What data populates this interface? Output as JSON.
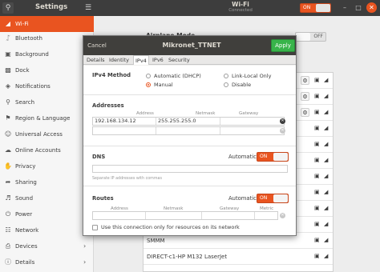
{
  "header": {
    "app_title": "Settings",
    "panel_title": "Wi-Fi",
    "panel_subtitle": "Connected",
    "wifi_toggle": "ON",
    "search_icon": "search-icon",
    "menu_icon": "hamburger-menu-icon"
  },
  "sidebar": {
    "items": [
      {
        "label": "Wi-Fi",
        "icon": "wifi-icon",
        "selected": true
      },
      {
        "label": "Bluetooth",
        "icon": "bluetooth-icon"
      },
      {
        "label": "Background",
        "icon": "background-icon"
      },
      {
        "label": "Dock",
        "icon": "dock-icon"
      },
      {
        "label": "Notifications",
        "icon": "bell-icon"
      },
      {
        "label": "Search",
        "icon": "search-icon"
      },
      {
        "label": "Region & Language",
        "icon": "flag-icon"
      },
      {
        "label": "Universal Access",
        "icon": "accessibility-icon"
      },
      {
        "label": "Online Accounts",
        "icon": "cloud-icon"
      },
      {
        "label": "Privacy",
        "icon": "hand-icon"
      },
      {
        "label": "Sharing",
        "icon": "share-icon"
      },
      {
        "label": "Sound",
        "icon": "speaker-icon"
      },
      {
        "label": "Power",
        "icon": "power-icon"
      },
      {
        "label": "Network",
        "icon": "network-icon"
      },
      {
        "label": "Devices",
        "icon": "printer-icon",
        "chevron": true
      },
      {
        "label": "Details",
        "icon": "info-icon",
        "chevron": true
      }
    ]
  },
  "main": {
    "airplane_mode_label": "Airplane Mode",
    "airplane_toggle": "OFF",
    "networks": [
      {
        "name": ""
      },
      {
        "name": ""
      },
      {
        "name": ""
      },
      {
        "name": ""
      },
      {
        "name": ""
      },
      {
        "name": ""
      },
      {
        "name": ""
      },
      {
        "name": ""
      },
      {
        "name": ""
      },
      {
        "name": ""
      },
      {
        "name": "SMMM"
      },
      {
        "name": "DIRECT-c1-HP M132 LaserJet"
      }
    ]
  },
  "dialog": {
    "cancel_label": "Cancel",
    "title": "Mikronet_TTNET",
    "apply_label": "Apply",
    "tabs": [
      "Details",
      "Identity",
      "IPv4",
      "IPv6",
      "Security"
    ],
    "active_tab": "IPv4",
    "ipv4_method_label": "IPv4 Method",
    "methods": {
      "automatic_dhcp": "Automatic (DHCP)",
      "link_local": "Link-Local Only",
      "manual": "Manual",
      "disable": "Disable"
    },
    "selected_method": "Manual",
    "addresses_label": "Addresses",
    "address_headers": {
      "address": "Address",
      "netmask": "Netmask",
      "gateway": "Gateway"
    },
    "address_rows": [
      {
        "address": "192.168.134.12",
        "netmask": "255.255.255.0",
        "gateway": ""
      },
      {
        "address": "",
        "netmask": "",
        "gateway": ""
      }
    ],
    "dns_label": "DNS",
    "dns_automatic_label": "Automatic",
    "dns_toggle": "ON",
    "dns_value": "",
    "dns_hint": "Separate IP addresses with commas",
    "routes_label": "Routes",
    "routes_automatic_label": "Automatic",
    "routes_toggle": "ON",
    "route_headers": {
      "address": "Address",
      "netmask": "Netmask",
      "gateway": "Gateway",
      "metric": "Metric"
    },
    "local_only_label": "Use this connection only for resources on its network"
  },
  "colors": {
    "accent": "#e95420",
    "apply": "#38b44a",
    "header": "#3d3d3d"
  }
}
